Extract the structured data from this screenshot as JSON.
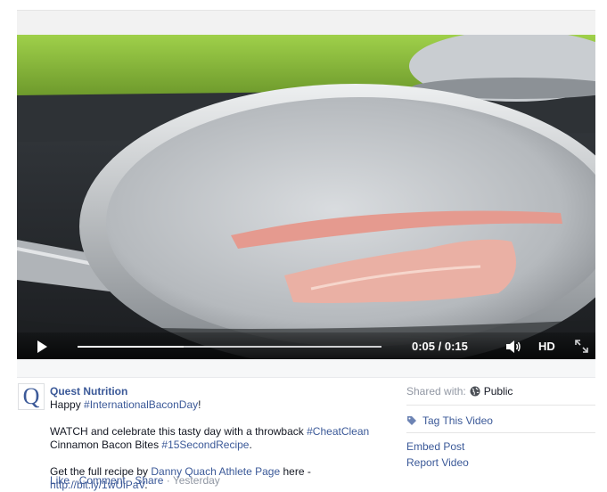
{
  "video": {
    "current_time": "0:05",
    "duration": "0:15",
    "time_display": "0:05 / 0:15",
    "progress": 0.35,
    "hd_label": "HD"
  },
  "post": {
    "author": "Quest Nutrition",
    "avatar_letter": "Q",
    "line1_prefix": "Happy ",
    "hashtag1": "#InternationalBaconDay",
    "line1_suffix": "!",
    "line2_prefix": "WATCH and celebrate this tasty day with a throwback ",
    "hashtag2": "#CheatClean",
    "line3_prefix": "Cinnamon Bacon Bites ",
    "hashtag3": "#15SecondRecipe",
    "line3_suffix": ".",
    "line4_prefix": "Get the full recipe by ",
    "athlete_link": "Danny Quach Athlete Page",
    "line4_mid": " here - ",
    "url_link": "http://bit.ly/1wUiPaV",
    "line4_suffix": "."
  },
  "actions": {
    "like": "Like",
    "comment": "Comment",
    "share": "Share",
    "timestamp": "Yesterday",
    "separator": " · "
  },
  "side": {
    "shared_with_label": "Shared with:",
    "audience": "Public",
    "tag_video": "Tag This Video",
    "embed_post": "Embed Post",
    "report_video": "Report Video"
  },
  "colors": {
    "link": "#3b5998",
    "muted": "#9197a3",
    "text": "#141823"
  }
}
